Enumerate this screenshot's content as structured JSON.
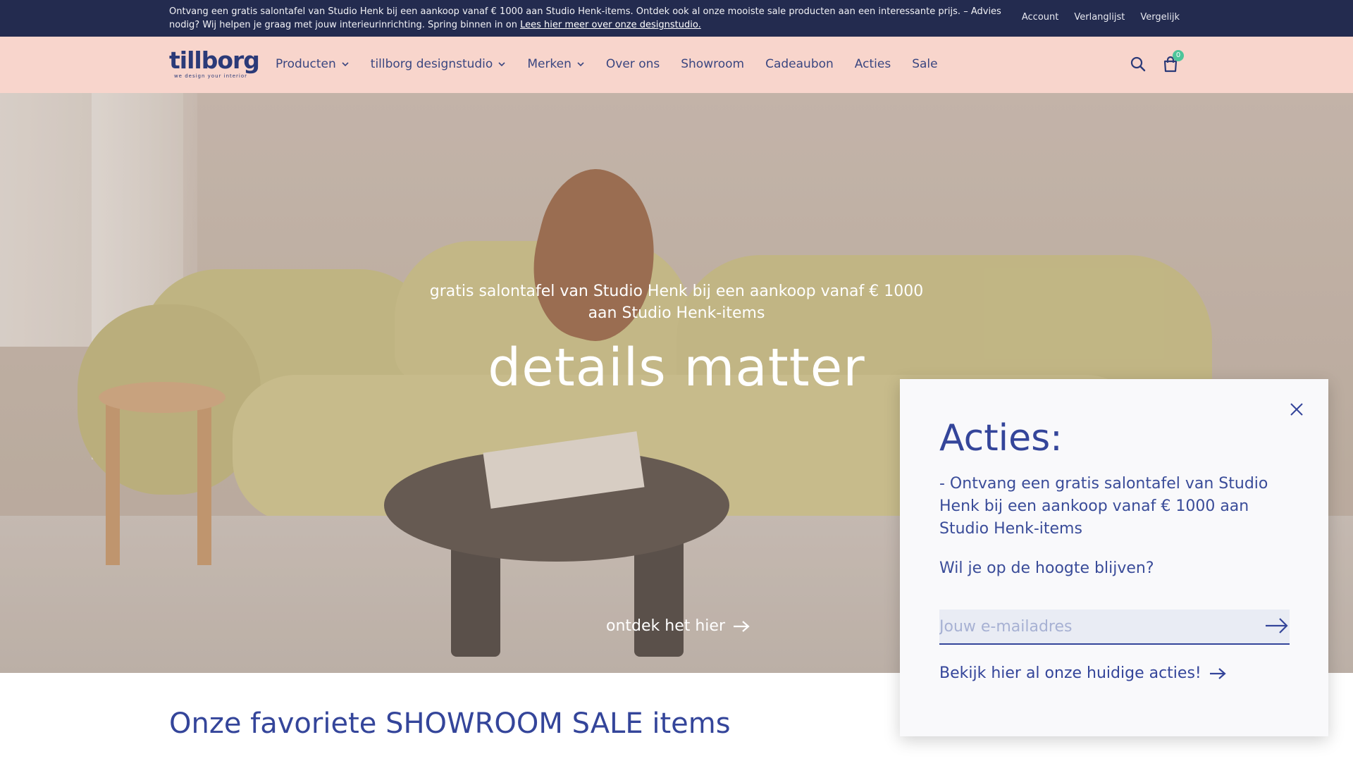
{
  "announcement": {
    "text": "Ontvang een gratis salontafel van Studio Henk bij een aankoop vanaf € 1000 aan Studio Henk-items. Ontdek ook al onze mooiste sale producten aan een interessante prijs. – Advies nodig? Wij helpen je graag met jouw interieurinrichting. Spring binnen in on",
    "link_text": "Lees hier meer over onze designstudio.",
    "links": [
      "Account",
      "Verlanglijst",
      "Vergelijk"
    ]
  },
  "header": {
    "logo_text": "tillborg",
    "logo_tagline": "we design your interior",
    "nav": [
      {
        "label": "Producten",
        "has_dropdown": true
      },
      {
        "label": "tillborg designstudio",
        "has_dropdown": true
      },
      {
        "label": "Merken",
        "has_dropdown": true
      },
      {
        "label": "Over ons",
        "has_dropdown": false
      },
      {
        "label": "Showroom",
        "has_dropdown": false
      },
      {
        "label": "Cadeaubon",
        "has_dropdown": false
      },
      {
        "label": "Acties",
        "has_dropdown": false
      },
      {
        "label": "Sale",
        "has_dropdown": false
      }
    ],
    "search_icon": "search-icon",
    "cart_icon": "shopping-bag-icon",
    "cart_count": "0"
  },
  "hero": {
    "subtitle": "gratis salontafel van Studio Henk bij een aankoop vanaf € 1000 aan Studio Henk-items",
    "title": "details matter",
    "cta_label": "ontdek het hier",
    "cta_icon": "arrow-right-icon"
  },
  "section": {
    "title": "Onze favoriete SHOWROOM SALE items"
  },
  "popup": {
    "title": "Acties:",
    "description": "- Ontvang een gratis salontafel van Studio Henk bij een aankoop vanaf € 1000 aan Studio Henk-items",
    "question": "Wil je op de hoogte blijven?",
    "email_placeholder": "Jouw e-mailadres",
    "email_value": "",
    "link_label": "Bekijk hier al onze huidige acties!",
    "close_icon": "close-icon"
  },
  "colors": {
    "topbar_bg": "#232b4f",
    "header_bg": "#f8d5cc",
    "brand_blue": "#34459a",
    "badge_green": "#4dc59a"
  }
}
